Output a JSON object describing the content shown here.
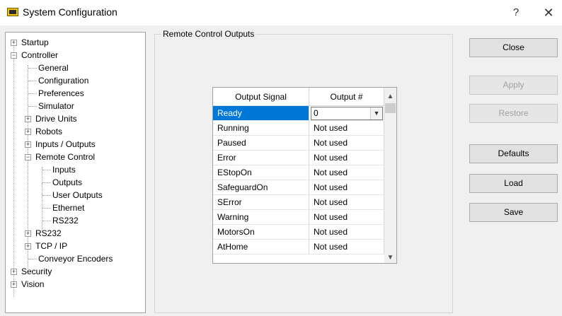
{
  "window": {
    "title": "System Configuration",
    "help_label": "?",
    "close_label": "✕"
  },
  "tree": {
    "items": [
      {
        "label": "Startup",
        "expander": "+"
      },
      {
        "label": "Controller",
        "expander": "−"
      },
      {
        "label": "General"
      },
      {
        "label": "Configuration"
      },
      {
        "label": "Preferences"
      },
      {
        "label": "Simulator"
      },
      {
        "label": "Drive Units",
        "expander": "+"
      },
      {
        "label": "Robots",
        "expander": "+"
      },
      {
        "label": "Inputs / Outputs",
        "expander": "+"
      },
      {
        "label": "Remote Control",
        "expander": "−"
      },
      {
        "label": "Inputs"
      },
      {
        "label": "Outputs"
      },
      {
        "label": "User Outputs"
      },
      {
        "label": "Ethernet"
      },
      {
        "label": "RS232"
      },
      {
        "label": "RS232",
        "expander": "+"
      },
      {
        "label": "TCP / IP",
        "expander": "+"
      },
      {
        "label": "Conveyor Encoders"
      },
      {
        "label": "Security",
        "expander": "+"
      },
      {
        "label": "Vision",
        "expander": "+"
      }
    ]
  },
  "panel": {
    "title": "Remote Control Outputs"
  },
  "grid": {
    "headers": [
      "Output Signal",
      "Output #"
    ],
    "rows": [
      {
        "signal": "Ready",
        "output": "0"
      },
      {
        "signal": "Running",
        "output": "Not used"
      },
      {
        "signal": "Paused",
        "output": "Not used"
      },
      {
        "signal": "Error",
        "output": "Not used"
      },
      {
        "signal": "EStopOn",
        "output": "Not used"
      },
      {
        "signal": "SafeguardOn",
        "output": "Not used"
      },
      {
        "signal": "SError",
        "output": "Not used"
      },
      {
        "signal": "Warning",
        "output": "Not used"
      },
      {
        "signal": "MotorsOn",
        "output": "Not used"
      },
      {
        "signal": "AtHome",
        "output": "Not used"
      }
    ],
    "scroll_up": "▲",
    "scroll_down": "▼",
    "combo_arrow": "▼"
  },
  "buttons": {
    "close": "Close",
    "apply": "Apply",
    "restore": "Restore",
    "defaults": "Defaults",
    "load": "Load",
    "save": "Save"
  },
  "colors": {
    "selection": "#0078d7",
    "background": "#f0f0f0"
  }
}
